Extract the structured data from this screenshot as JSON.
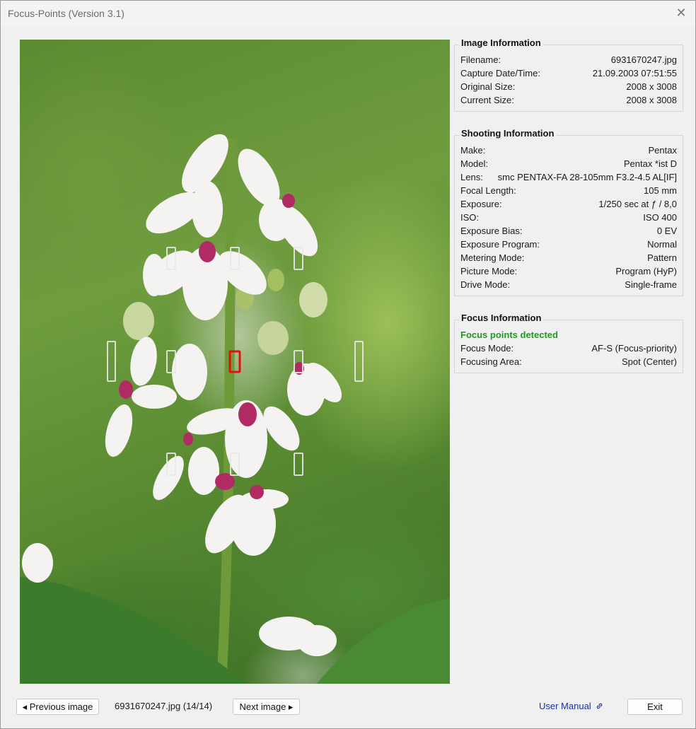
{
  "window": {
    "title": "Focus-Points (Version 3.1)",
    "close_glyph": "✕"
  },
  "image_info": {
    "heading": "Image Information",
    "rows": [
      {
        "label": "Filename:",
        "value": "6931670247.jpg"
      },
      {
        "label": "Capture Date/Time:",
        "value": "21.09.2003 07:51:55"
      },
      {
        "label": "Original Size:",
        "value": "2008 x 3008"
      },
      {
        "label": "Current Size:",
        "value": "2008 x 3008"
      }
    ]
  },
  "shooting_info": {
    "heading": "Shooting Information",
    "rows": [
      {
        "label": "Make:",
        "value": "Pentax"
      },
      {
        "label": "Model:",
        "value": "Pentax *ist D"
      },
      {
        "label": "Lens:",
        "value": "smc PENTAX-FA 28-105mm F3.2-4.5 AL[IF]"
      },
      {
        "label": "Focal Length:",
        "value": "105 mm"
      },
      {
        "label": "Exposure:",
        "value": "1/250 sec at ƒ / 8,0"
      },
      {
        "label": "ISO:",
        "value": "ISO 400"
      },
      {
        "label": "Exposure Bias:",
        "value": "0 EV"
      },
      {
        "label": "Exposure Program:",
        "value": "Normal"
      },
      {
        "label": "Metering Mode:",
        "value": "Pattern"
      },
      {
        "label": "Picture Mode:",
        "value": "Program (HyP)"
      },
      {
        "label": "Drive Mode:",
        "value": "Single-frame"
      }
    ]
  },
  "focus_info": {
    "heading": "Focus Information",
    "status": "Focus points detected",
    "status_color": "#1e9a1e",
    "rows": [
      {
        "label": "Focus Mode:",
        "value": "AF-S (Focus-priority)"
      },
      {
        "label": "Focusing Area:",
        "value": "Spot (Center)"
      }
    ]
  },
  "photo": {
    "active_point_color": "#e01010",
    "inactive_point_color": "#e8e8e8"
  },
  "bottom": {
    "prev_label": "◂ Previous image",
    "counter": "6931670247.jpg (14/14)",
    "next_label": "Next image ▸",
    "manual_label": "User Manual",
    "manual_icon": "link-icon",
    "exit_label": "Exit"
  }
}
